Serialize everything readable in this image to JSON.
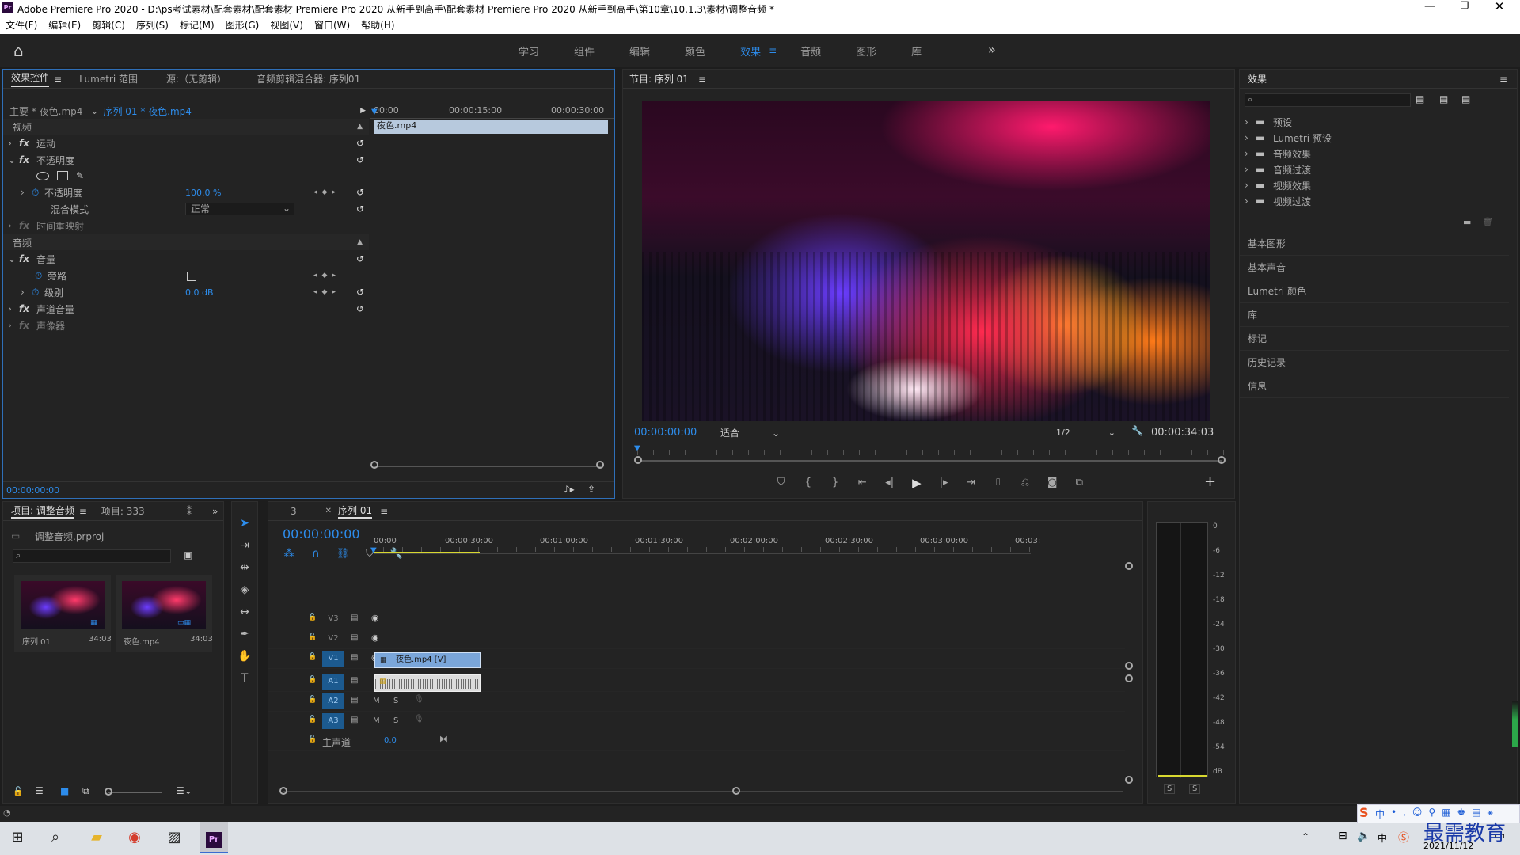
{
  "window": {
    "title": "Adobe Premiere Pro 2020 - D:\\ps考试素材\\配套素材\\配套素材 Premiere Pro 2020 从新手到高手\\配套素材 Premiere Pro 2020 从新手到高手\\第10章\\10.1.3\\素材\\调整音频 *",
    "app_icon": "Pr"
  },
  "menu": [
    "文件(F)",
    "编辑(E)",
    "剪辑(C)",
    "序列(S)",
    "标记(M)",
    "图形(G)",
    "视图(V)",
    "窗口(W)",
    "帮助(H)"
  ],
  "workspaces": {
    "items": [
      "学习",
      "组件",
      "编辑",
      "颜色",
      "效果",
      "音频",
      "图形",
      "库"
    ],
    "active": "效果",
    "more": "»"
  },
  "effect_controls": {
    "tabs": [
      "效果控件",
      "Lumetri 范围",
      "源:（无剪辑）",
      "音频剪辑混合器: 序列01"
    ],
    "master": "主要 * 夜色.mp4",
    "sequence_clip": "序列 01 * 夜色.mp4",
    "ruler": [
      "00:00",
      "00:00:15:00",
      "00:00:30:00"
    ],
    "clip_label": "夜色.mp4",
    "video_header": "视频",
    "motion": "运动",
    "opacity": "不透明度",
    "opacity_param": "不透明度",
    "opacity_value": "100.0 %",
    "blend_mode": "混合模式",
    "blend_value": "正常",
    "time_remap": "时间重映射",
    "audio_header": "音频",
    "volume": "音量",
    "bypass": "旁路",
    "level": "级别",
    "level_value": "0.0 dB",
    "channel_volume": "声道音量",
    "panner": "声像器",
    "timecode": "00:00:00:00"
  },
  "program": {
    "title": "节目: 序列 01",
    "timecode": "00:00:00:00",
    "fit": "适合",
    "resolution": "1/2",
    "duration": "00:00:34:03"
  },
  "effects_panel": {
    "title": "效果",
    "tree": [
      "预设",
      "Lumetri 预设",
      "音频效果",
      "音频过渡",
      "视频效果",
      "视频过渡"
    ],
    "sections": [
      "基本图形",
      "基本声音",
      "Lumetri 颜色",
      "库",
      "标记",
      "历史记录",
      "信息"
    ]
  },
  "project": {
    "tabs": [
      "项目: 调整音频",
      "项目: 333"
    ],
    "file": "调整音频.prproj",
    "items": [
      {
        "name": "序列 01",
        "duration": "34:03"
      },
      {
        "name": "夜色.mp4",
        "duration": "34:03"
      }
    ]
  },
  "timeline": {
    "tabs": [
      "3",
      "序列 01"
    ],
    "timecode": "00:00:00:00",
    "ruler": [
      "00:00",
      "00:00:30:00",
      "00:01:00:00",
      "00:01:30:00",
      "00:02:00:00",
      "00:02:30:00",
      "00:03:00:00",
      "00:03:"
    ],
    "video_tracks": [
      "V3",
      "V2",
      "V1"
    ],
    "audio_tracks": [
      "A1",
      "A2",
      "A3"
    ],
    "master_label": "主声道",
    "master_value": "0.0",
    "video_clip": "夜色.mp4 [V]",
    "mute": "M",
    "solo": "S"
  },
  "meter": {
    "labels": [
      "0",
      "-6",
      "-12",
      "-18",
      "-24",
      "-30",
      "-36",
      "-42",
      "-48",
      "-54",
      "dB"
    ],
    "solo_labels": [
      "S",
      "S"
    ]
  },
  "taskbar": {
    "date": "2021/11/12",
    "watermark": "最需教育",
    "ime": "中"
  }
}
